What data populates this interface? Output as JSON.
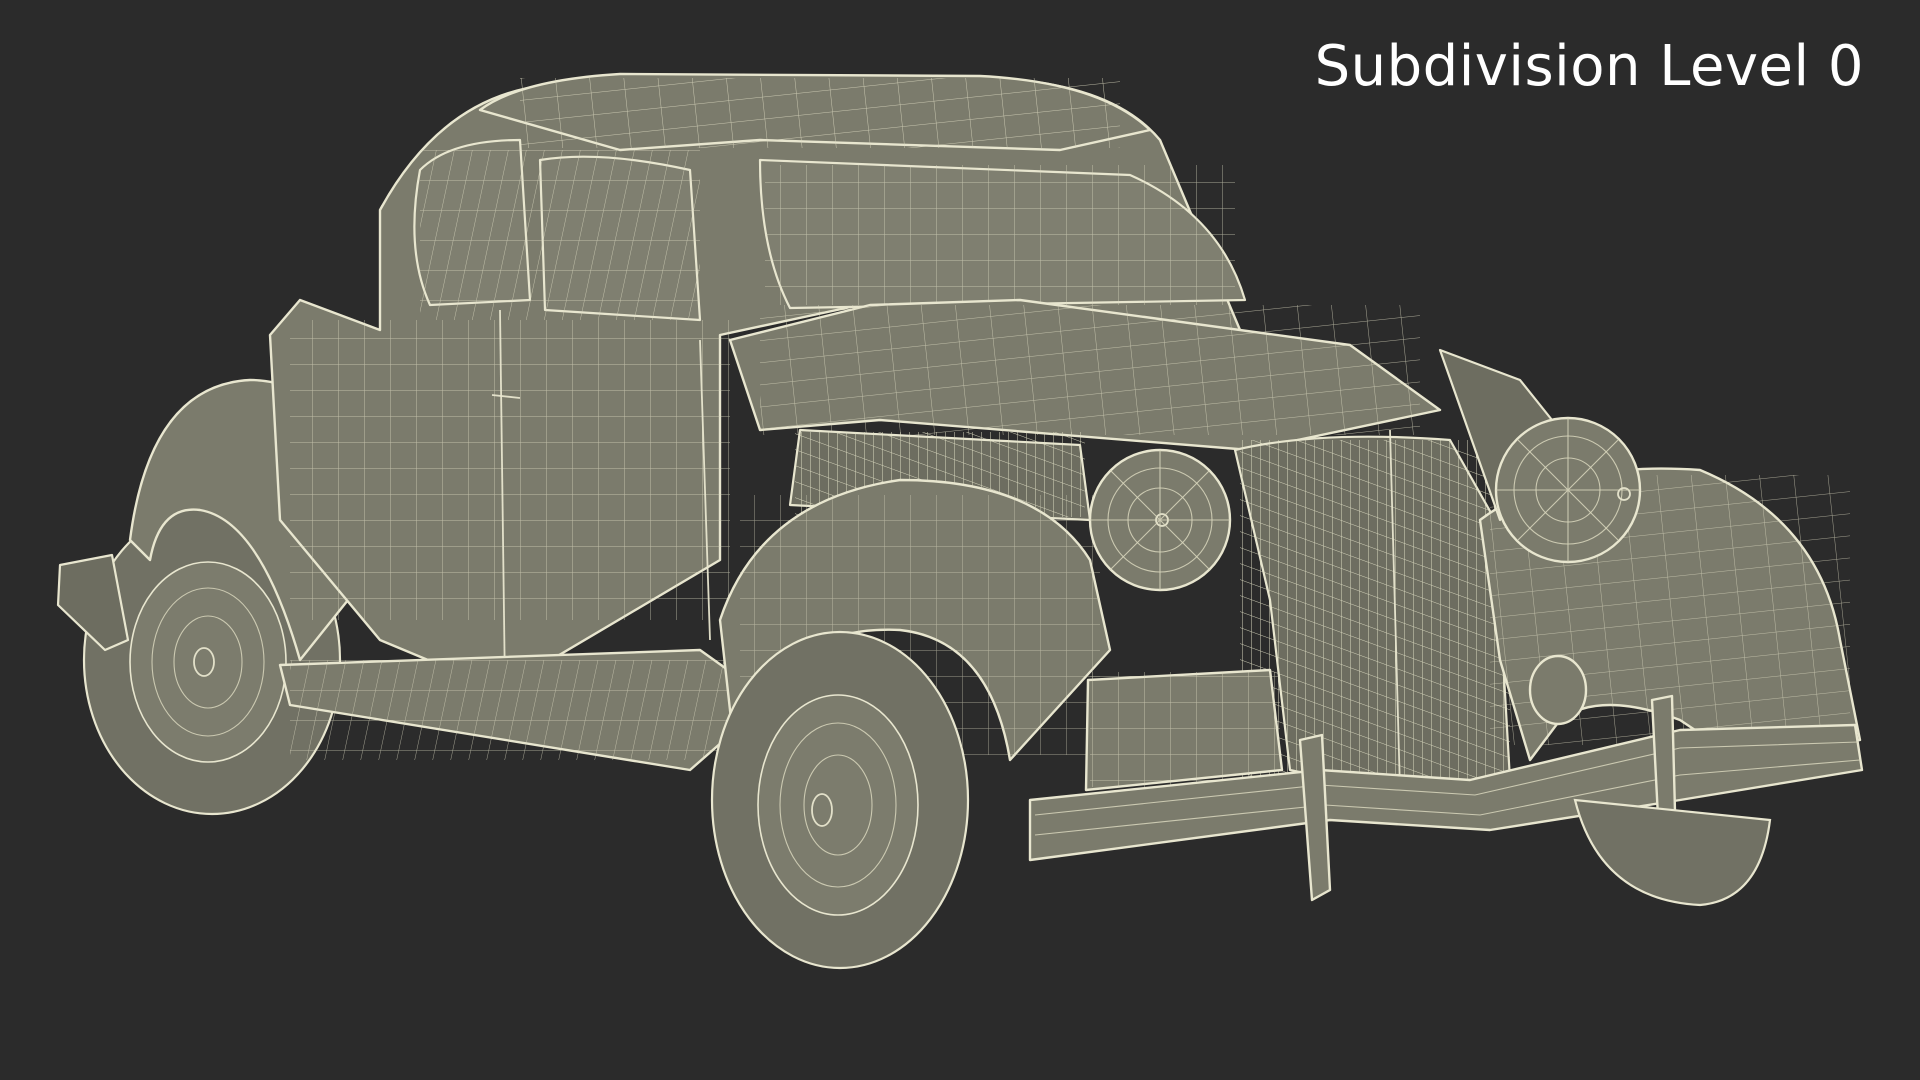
{
  "viewport": {
    "background": "#2b2b2b",
    "mesh_fill": "#7b7b6c",
    "wire_color": "#e8e6cf"
  },
  "overlay": {
    "label": "Subdivision Level 0"
  },
  "model": {
    "icon": "wireframe-car-icon"
  }
}
